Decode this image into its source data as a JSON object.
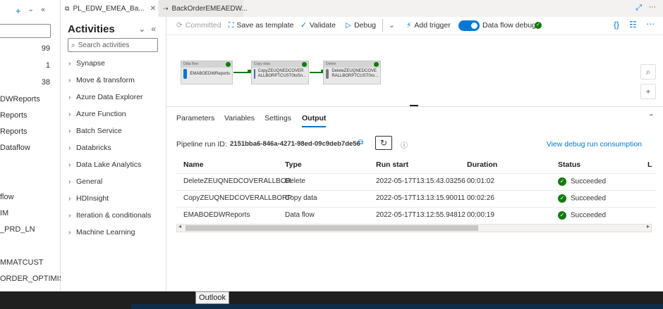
{
  "tabs": [
    {
      "label": "PL_EDW_EMEA_Ba...",
      "icon": "pipeline-icon",
      "active": true
    },
    {
      "label": "BackOrderEMEAEDW...",
      "icon": "dataflow-icon",
      "active": false
    }
  ],
  "left_panel": {
    "counts": [
      "99",
      "1",
      "38"
    ],
    "items": [
      "DWReports",
      "Reports",
      "Reports",
      "Dataflow",
      "flow",
      "IM",
      "_PRD_LN",
      "MMATCUST",
      "ORDER_OPTIMISE"
    ]
  },
  "activities": {
    "title": "Activities",
    "search_placeholder": "Search activities",
    "categories": [
      "Synapse",
      "Move & transform",
      "Azure Data Explorer",
      "Azure Function",
      "Batch Service",
      "Databricks",
      "Data Lake Analytics",
      "General",
      "HDInsight",
      "Iteration & conditionals",
      "Machine Learning"
    ]
  },
  "toolbar": {
    "committed": "Committed",
    "save_template": "Save as template",
    "validate": "Validate",
    "debug": "Debug",
    "add_trigger": "Add trigger",
    "dataflow_debug": "Data flow debug"
  },
  "canvas": {
    "nodes": [
      {
        "type": "Data flow",
        "name": "EMABOEDWReports",
        "color": "#0078d4"
      },
      {
        "type": "Copy data",
        "name": "CopyZEUQNEDCOVER ALLBORPTCUST0toSn...",
        "color": "#4a6fa5"
      },
      {
        "type": "Delete",
        "name": "DeleteZEUQNEDCOVE RALLBORPTCUST0ro...",
        "color": "#7a7a7a"
      }
    ]
  },
  "bottom": {
    "tabs": [
      "Parameters",
      "Variables",
      "Settings",
      "Output"
    ],
    "run_id_label": "Pipeline run ID:",
    "run_id": "2151bba6-846a-4271-98ed-09c9deb7de56",
    "consumption_link": "View debug run consumption",
    "columns": [
      "Name",
      "Type",
      "Run start",
      "Duration",
      "Status",
      "L"
    ],
    "rows": [
      {
        "name": "DeleteZEUQNEDCOVERALLBOR",
        "type": "Delete",
        "run_start": "2022-05-17T13:15:43.03256",
        "duration": "00:01:02",
        "status": "Succeeded"
      },
      {
        "name": "CopyZEUQNEDCOVERALLBORP",
        "type": "Copy data",
        "run_start": "2022-05-17T13:13:15.90011",
        "duration": "00:02:26",
        "status": "Succeeded"
      },
      {
        "name": "EMABOEDWReports",
        "type": "Data flow",
        "run_start": "2022-05-17T13:12:55.94812",
        "duration": "00:00:19",
        "status": "Succeeded"
      }
    ]
  },
  "taskbar": {
    "tooltip": "Outlook"
  },
  "colors": {
    "accent": "#0078d4",
    "success": "#107c10"
  }
}
